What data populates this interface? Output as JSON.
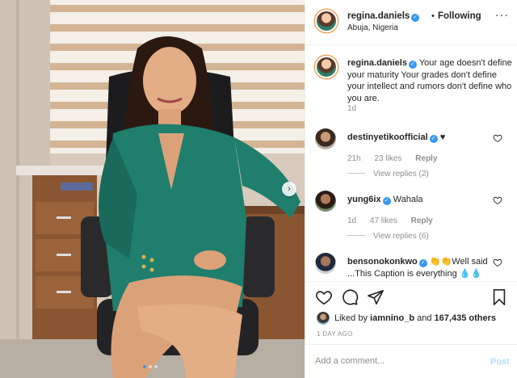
{
  "header": {
    "username": "regina.daniels",
    "dot": "•",
    "follow_status": "Following",
    "location": "Abuja, Nigeria",
    "more": "···"
  },
  "caption": {
    "username": "regina.daniels",
    "text": "Your age doesn't define your maturity Your grades don't define your intellect and rumors don't define who you are.",
    "time": "1d"
  },
  "comments": [
    {
      "username": "destinyetikoofficial",
      "text": "♥",
      "time": "21h",
      "likes": "23 likes",
      "reply_label": "Reply",
      "view_replies": "View replies (2)"
    },
    {
      "username": "yung6ix",
      "text": "Wahala",
      "time": "1d",
      "likes": "47 likes",
      "reply_label": "Reply",
      "view_replies": "View replies (6)"
    },
    {
      "username": "bensonokonkwo",
      "text": "👏👏Well said ...This Caption is everything 💧💧"
    }
  ],
  "likes": {
    "prefix": "Liked by",
    "user": "iamnino_b",
    "and": "and",
    "count": "167,435 others"
  },
  "time_ago": "1 DAY AGO",
  "add_comment": {
    "placeholder": "Add a comment...",
    "post_label": "Post"
  },
  "colors": {
    "accent": "#3897f0",
    "text": "#262626",
    "muted": "#8e8e8e",
    "border": "#efefef",
    "post_disabled": "#b2dffc"
  }
}
